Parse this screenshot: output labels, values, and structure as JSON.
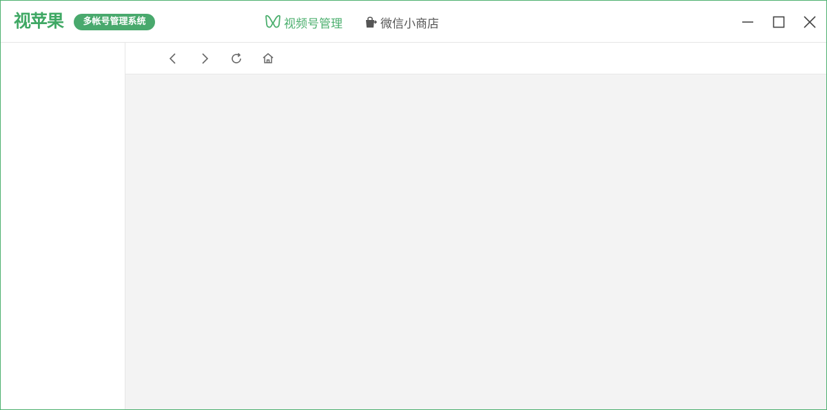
{
  "app": {
    "logo_text": "视苹果",
    "badge_text": "多帐号管理系统"
  },
  "nav": {
    "tabs": [
      {
        "label": "视频号管理",
        "icon": "channels-butterfly-icon",
        "active": true
      },
      {
        "label": "微信小商店",
        "icon": "shopping-bag-icon",
        "active": false
      }
    ]
  },
  "window_controls": {
    "minimize": "minimize-icon",
    "maximize": "maximize-icon",
    "close": "close-icon"
  },
  "toolbar": {
    "icons": [
      "back-icon",
      "forward-icon",
      "refresh-icon",
      "home-icon"
    ]
  },
  "colors": {
    "accent": "#4caf6e",
    "text_inactive": "#555555",
    "content_bg": "#f3f3f3",
    "border": "#e6e6e6"
  }
}
